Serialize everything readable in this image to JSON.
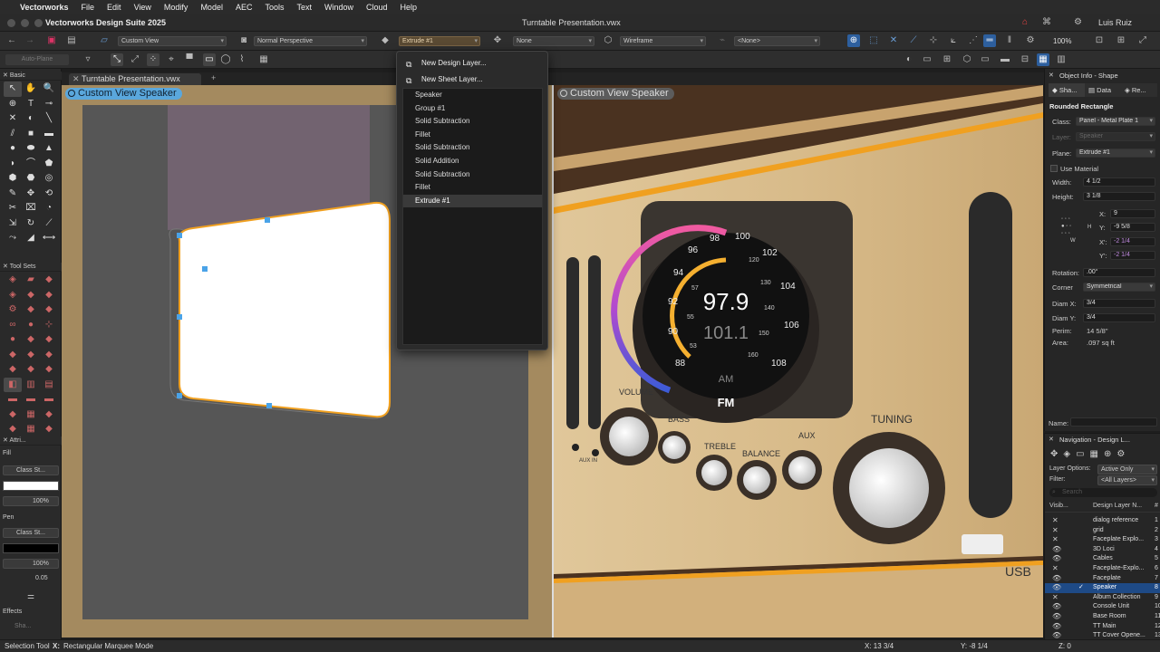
{
  "menubar": {
    "app": "Vectorworks",
    "items": [
      "File",
      "Edit",
      "View",
      "Modify",
      "Model",
      "AEC",
      "Tools",
      "Text",
      "Window",
      "Cloud",
      "Help"
    ]
  },
  "titlebar": {
    "app_title": "Vectorworks Design Suite 2025",
    "doc_title": "Turntable Presentation.vwx",
    "user": "Luis Ruiz"
  },
  "toolbar1": {
    "view": "Custom View",
    "perspective": "Normal Perspective",
    "plane": "Extrude #1",
    "snap": "None",
    "render": "Wireframe",
    "class_filter": "<None>",
    "zoom": "100%"
  },
  "toolbar2": {
    "auto_plane": "Auto-Plane"
  },
  "palettes": {
    "basic": "Basic",
    "tool_sets": "Tool Sets",
    "attributes": "Attri...",
    "fill_label": "Fill",
    "fill_class": "Class St...",
    "fill_opacity": "100%",
    "pen_label": "Pen",
    "pen_class": "Class St...",
    "pen_opacity": "100%",
    "pen_weight": "0.05",
    "effects_label": "Effects",
    "shadow": "Sha..."
  },
  "doc_tab": "Turntable Presentation.vwx",
  "viewport_left_label": "Custom View  Speaker",
  "viewport_right_label": "Custom View  Speaker",
  "radio": {
    "freq_main": "97.9",
    "freq_sub": "101.1",
    "am": "AM",
    "fm": "FM",
    "scale": [
      "98",
      "100",
      "102",
      "104",
      "106",
      "108",
      "96",
      "94",
      "92",
      "90",
      "88"
    ],
    "inner_scale": [
      "120",
      "130",
      "140",
      "150",
      "160",
      "53",
      "55",
      "57"
    ],
    "knobs": [
      "VOLUME",
      "BASS",
      "TREBLE",
      "BALANCE",
      "AUX",
      "TUNING"
    ],
    "aux_in": "AUX IN",
    "usb": "USB"
  },
  "dropdown": {
    "new_design_layer": "New Design Layer...",
    "new_sheet_layer": "New Sheet Layer...",
    "items": [
      "Speaker",
      "Group #1",
      "Solid Subtraction",
      "Fillet",
      "Solid Subtraction",
      "Solid Addition",
      "Solid Subtraction",
      "Fillet",
      "Extrude #1"
    ]
  },
  "object_info": {
    "title": "Object Info - Shape",
    "tabs": [
      "Sha...",
      "Data",
      "Re..."
    ],
    "shape_name": "Rounded Rectangle",
    "class_label": "Class:",
    "class_value": "Panel - Metal Plate 1",
    "layer_label": "Layer:",
    "layer_value": "Speaker",
    "plane_label": "Plane:",
    "plane_value": "Extrude #1",
    "use_material": "Use Material",
    "width_label": "Width:",
    "width_value": "4 1/2",
    "height_label": "Height:",
    "height_value": "3 1/8",
    "x_label": "X:",
    "x_value": "9",
    "y_label": "Y:",
    "y_value": "-9 5/8",
    "xp_label": "X':",
    "xp_value": "-2 1/4",
    "yp_label": "Y':",
    "yp_value": "-2 1/4",
    "rotation_label": "Rotation:",
    "rotation_value": ".00°",
    "corner_label": "Corner",
    "corner_value": "Symmetrical",
    "diamx_label": "Diam X:",
    "diamx_value": "3/4",
    "diamy_label": "Diam Y:",
    "diamy_value": "3/4",
    "perim_label": "Perim:",
    "perim_value": "14 5/8\"",
    "area_label": "Area:",
    "area_value": ".097 sq ft",
    "name_label": "Name:",
    "h_label": "H",
    "w_label": "W"
  },
  "navigation": {
    "title": "Navigation - Design L...",
    "layer_options_label": "Layer Options:",
    "layer_options_value": "Active Only",
    "filter_label": "Filter:",
    "filter_value": "<All Layers>",
    "search_placeholder": "Search",
    "col_vis": "Visib...",
    "col_name": "Design Layer N...",
    "col_num": "#",
    "layers": [
      {
        "name": "dialog reference",
        "num": "1",
        "vis": "x"
      },
      {
        "name": "grid",
        "num": "2",
        "vis": "x"
      },
      {
        "name": "Faceplate Explo...",
        "num": "3",
        "vis": "x"
      },
      {
        "name": "3D Loci",
        "num": "4",
        "vis": "eye"
      },
      {
        "name": "Cables",
        "num": "5",
        "vis": "eye"
      },
      {
        "name": "Faceplate-Explo...",
        "num": "6",
        "vis": "x"
      },
      {
        "name": "Faceplate",
        "num": "7",
        "vis": "eye"
      },
      {
        "name": "Speaker",
        "num": "8",
        "vis": "eye"
      },
      {
        "name": "Album Collection",
        "num": "9",
        "vis": "x"
      },
      {
        "name": "Console Unit",
        "num": "10",
        "vis": "eye"
      },
      {
        "name": "Base Room",
        "num": "11",
        "vis": "eye"
      },
      {
        "name": "TT Main",
        "num": "12",
        "vis": "eye"
      },
      {
        "name": "TT Cover Opene...",
        "num": "13",
        "vis": "eye"
      }
    ]
  },
  "status": {
    "tool": "Selection Tool",
    "mode_key": "X:",
    "mode": "Rectangular Marquee Mode",
    "x": "X: 13 3/4",
    "y": "Y: -8 1/4",
    "z": "Z: 0"
  },
  "colors": {
    "accent": "#2d6fd1",
    "selection_orange": "#f0a020",
    "handle_blue": "#4aa3e8"
  }
}
